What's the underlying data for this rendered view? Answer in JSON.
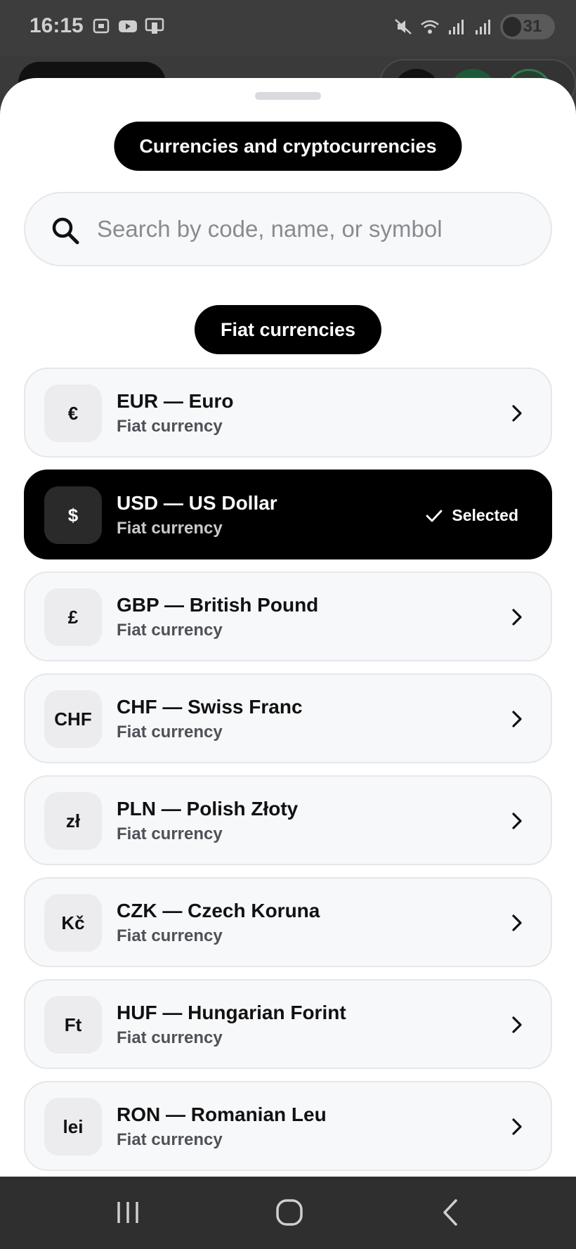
{
  "status_bar": {
    "time": "16:15",
    "battery": "31"
  },
  "sheet": {
    "title": "Currencies and cryptocurrencies",
    "search": {
      "placeholder": "Search by code, name, or symbol",
      "value": ""
    },
    "section_title": "Fiat currencies",
    "selected_label": "Selected",
    "currencies": [
      {
        "symbol": "€",
        "title": "EUR — Euro",
        "subtitle": "Fiat currency",
        "selected": false
      },
      {
        "symbol": "$",
        "title": "USD — US Dollar",
        "subtitle": "Fiat currency",
        "selected": true
      },
      {
        "symbol": "£",
        "title": "GBP — British Pound",
        "subtitle": "Fiat currency",
        "selected": false
      },
      {
        "symbol": "CHF",
        "title": "CHF — Swiss Franc",
        "subtitle": "Fiat currency",
        "selected": false
      },
      {
        "symbol": "zł",
        "title": "PLN — Polish Złoty",
        "subtitle": "Fiat currency",
        "selected": false
      },
      {
        "symbol": "Kč",
        "title": "CZK — Czech Koruna",
        "subtitle": "Fiat currency",
        "selected": false
      },
      {
        "symbol": "Ft",
        "title": "HUF — Hungarian Forint",
        "subtitle": "Fiat currency",
        "selected": false
      },
      {
        "symbol": "lei",
        "title": "RON — Romanian Leu",
        "subtitle": "Fiat currency",
        "selected": false
      }
    ]
  },
  "icons": {
    "status": [
      "screenshot-icon",
      "youtube-icon",
      "cast-icon",
      "mute-icon",
      "wifi-icon",
      "signal-icon",
      "signal-icon-2",
      "battery-icon"
    ],
    "nav": [
      "recent-apps-icon",
      "home-icon",
      "back-icon"
    ],
    "mascot": "blue-mascot-icon"
  },
  "colors": {
    "accent": "#000000",
    "row_bg": "#f7f8fa",
    "sheet_bg": "#ffffff",
    "mascot": "#2f7fe0"
  }
}
